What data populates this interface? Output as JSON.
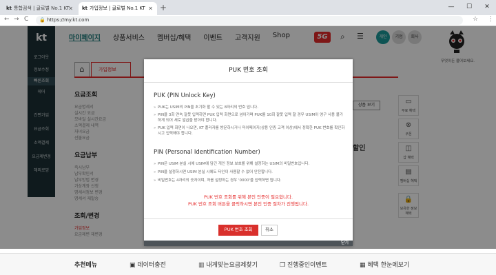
{
  "browser": {
    "tab1_title": "통합검색 | 글로벌 No.1 KT",
    "tab2_title": "가입정보 | 글로벌 No.1 KT",
    "favicon": "kt",
    "url": "https://my.kt.com",
    "new_tab": "+",
    "min": "—",
    "max": "☐",
    "close": "✕",
    "back": "←",
    "forward": "→",
    "reload": "C",
    "star": "☆",
    "menu": "⋮"
  },
  "leftbar": {
    "logo": "kt",
    "items": [
      "로그아웃",
      "정보수정",
      "빠른조회",
      "케어",
      "간편가입",
      "요금조회",
      "소액결제",
      "요금제변경",
      "해외로밍"
    ]
  },
  "topnav": {
    "items": [
      "마이페이지",
      "상품서비스",
      "멤버십/혜택",
      "이벤트",
      "고객지원",
      "Shop"
    ],
    "fiveg": "5G",
    "btn_personal": "개인",
    "btn_corp": "기업",
    "btn_company": "회사"
  },
  "mascot_caption": "무엇이든 물어보세요.",
  "breadcrumb_tab": "가입정보",
  "side_menu": {
    "h1": "요금조회",
    "h1_items": [
      "요금명세서",
      "실시간 요금",
      "모바일 실시간요금",
      "소액결제 내역",
      "자녀요금",
      "선불요금"
    ],
    "h2": "요금납부",
    "h2_items": [
      "즉시납부",
      "납부확인서",
      "납부방법 변경",
      "가상계좌 신청",
      "명세서정보 변경",
      "명세서 재발송"
    ],
    "h3": "조회/변경",
    "h3_items": [
      "가입정보",
      "요금제변 재변경"
    ]
  },
  "right_partial": {
    "btn": "상품 보기",
    "discount": "할인"
  },
  "right_col": [
    "무료 혜택",
    "쿠폰",
    "샵 혜택",
    "멤버십 혜택",
    "보유한 정보 혜택"
  ],
  "bottom": {
    "label": "추천메뉴",
    "items": [
      "데이터충전",
      "내게맞는요금제찾기",
      "진행중인이벤트",
      "혜택 한눈에보기"
    ]
  },
  "modal": {
    "title": "PUK 번호 조회",
    "puk_heading": "PUK (PIN Unlock Key)",
    "puk_lines": [
      "PUK는 USIM의 PIN을 초기화 할 수 있는 8자리의 번호 입니다.",
      "PIN을 3회 연속 잘못 입력하면 PUK 입력 화면으로 넘어가며 PUK를 10회 잘못 입력 할 경우 USIM이 영구 사용 불가하게 되어 새로 발급을 받아야 합니다.",
      "PUK 입력 화면이 나오면, KT 플라자를 방문하시거나 마이페이지(상용 인증 고객 이상)에서 정확한 PUK 번호를 확인하시고 입력해야 합니다."
    ],
    "pin_heading": "PIN (Personal Identification Number)",
    "pin_lines": [
      "PIN은 USIM 분실 시에 USIM에 담긴 개인 정보 보호를 위해 설정하는 USIM의 비밀번호입니다.",
      "PIN을 설정하시면 USIM 분실 시에도 타인이 사용할 수 없어 안전합니다.",
      "비밀번호는 4자리의 숫자이며, 처음 설정하는 경우 '0000'을 입력하면 됩니다."
    ],
    "notice_1": "PUK 번호 조회를 위해 본인 인증이 필요합니다.",
    "notice_2": "PUK 번호 조회 버튼을 클릭하시면 본인 인증 절차가 진행됩니다.",
    "btn_puk": "PUK 번호 조회",
    "btn_cancel": "취소",
    "close_label": "닫기"
  }
}
